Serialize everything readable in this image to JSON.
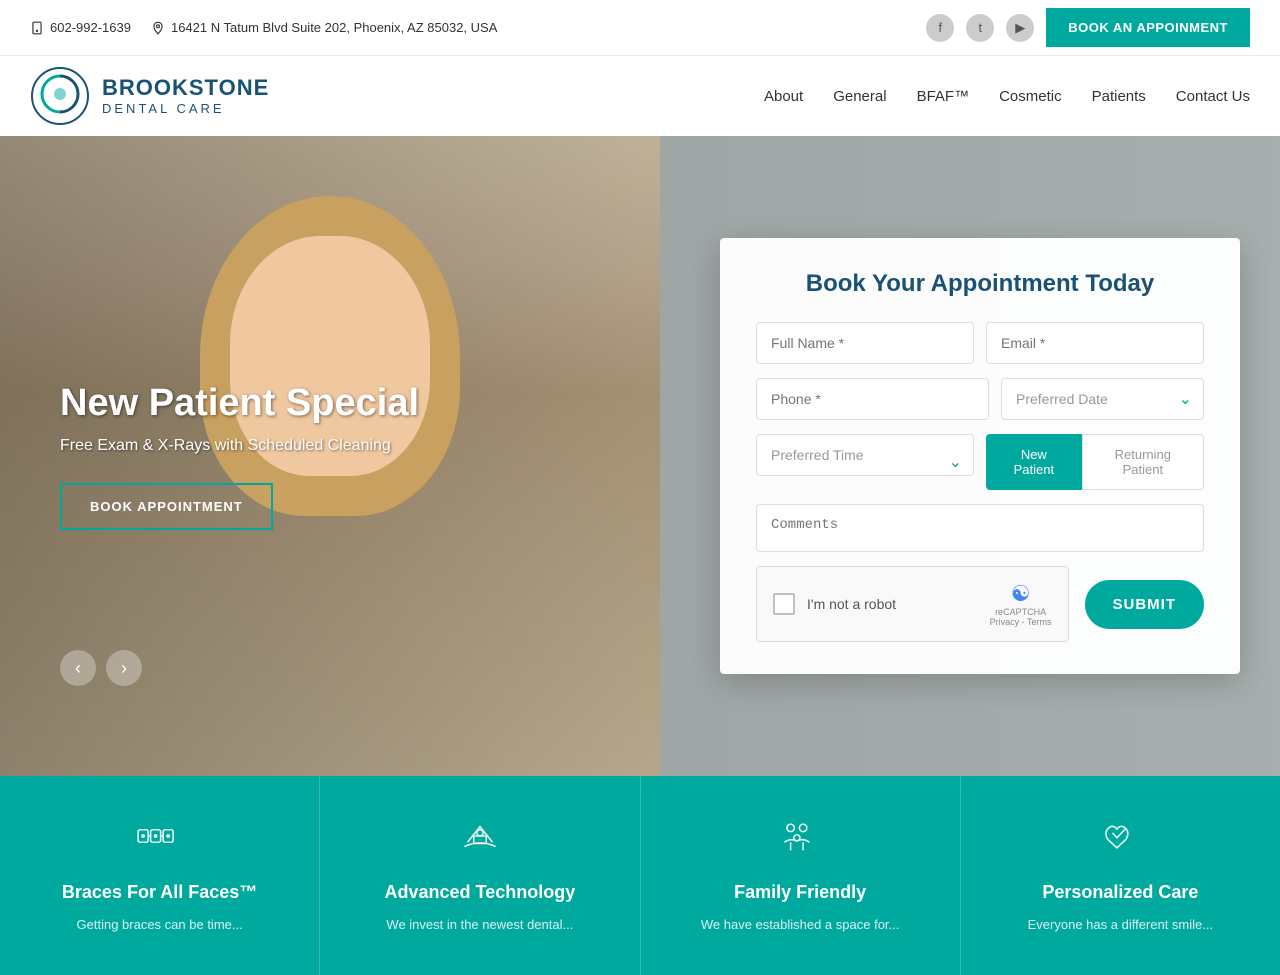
{
  "topbar": {
    "phone": "602-992-1639",
    "address": "16421 N Tatum Blvd Suite 202, Phoenix, AZ 85032, USA",
    "book_btn": "BOOK AN APPOINMENT"
  },
  "header": {
    "brand": "BROOKSTONE",
    "sub": "DENTAL CARE",
    "nav": [
      {
        "label": "About",
        "id": "about"
      },
      {
        "label": "General",
        "id": "general"
      },
      {
        "label": "BFAF™",
        "id": "bfaf"
      },
      {
        "label": "Cosmetic",
        "id": "cosmetic"
      },
      {
        "label": "Patients",
        "id": "patients"
      },
      {
        "label": "Contact Us",
        "id": "contact"
      }
    ]
  },
  "hero": {
    "title": "New Patient Special",
    "subtitle": "Free Exam & X-Rays with Scheduled Cleaning",
    "book_btn": "BOOK APPOINTMENT"
  },
  "form": {
    "title": "Book Your Appointment Today",
    "full_name_placeholder": "Full Name *",
    "email_placeholder": "Email *",
    "phone_placeholder": "Phone *",
    "preferred_date_label": "Preferred Date",
    "preferred_time_label": "Preferred Time",
    "new_patient_label": "New Patient",
    "returning_patient_label": "Returning Patient",
    "comments_placeholder": "Comments",
    "recaptcha_label": "I'm not a robot",
    "submit_label": "SUBMIT"
  },
  "features": [
    {
      "icon": "👓",
      "title": "Braces For All Faces™",
      "desc": "Getting braces can be time..."
    },
    {
      "icon": "🦷",
      "title": "Advanced Technology",
      "desc": "We invest in the newest dental..."
    },
    {
      "icon": "👨‍👩‍👧",
      "title": "Family Friendly",
      "desc": "We have established a space for..."
    },
    {
      "icon": "🤝",
      "title": "Personalized Care",
      "desc": "Everyone has a different smile..."
    }
  ]
}
